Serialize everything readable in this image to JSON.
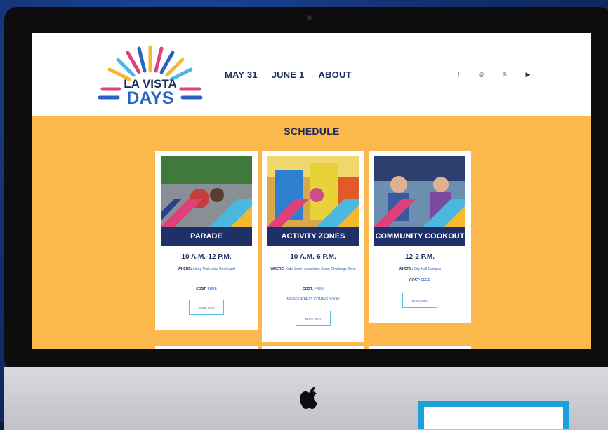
{
  "nav": {
    "items": [
      "MAY 31",
      "JUNE 1",
      "ABOUT"
    ]
  },
  "social": {
    "facebook": "f",
    "instagram": "◎",
    "x": "𝕏",
    "youtube": "▶"
  },
  "logo": {
    "line1": "LA VISTA",
    "line2": "DAYS"
  },
  "schedule": {
    "title": "SCHEDULE",
    "cards": [
      {
        "name": "PARADE",
        "time": "10 A.M.-12 P.M.",
        "where_label": "WHERE:",
        "where": "Along Park View Boulevard",
        "cost_label": "COST:",
        "cost": "FREE",
        "note": "",
        "button": "MORE INFO"
      },
      {
        "name": "ACTIVITY ZONES",
        "time": "10 A.M.-6 P.M.",
        "where_label": "WHERE:",
        "where": "Kid's Zone, Adventure Zone, Challenge Zone",
        "cost_label": "COST:",
        "cost": "FREE",
        "note": "MORE DETAILS COMING SOON",
        "button": "MORE INFO"
      },
      {
        "name": "COMMUNITY COOKOUT",
        "time": "12-2 P.M.",
        "where_label": "WHERE:",
        "where": "City Hall Campus",
        "cost_label": "COST:",
        "cost": "FREE",
        "note": "",
        "button": "MORE INFO"
      }
    ]
  },
  "colors": {
    "navy": "#1d2a5c",
    "orange": "#fbb84c",
    "blue": "#2b63c4",
    "accent": "#55c0e6"
  }
}
